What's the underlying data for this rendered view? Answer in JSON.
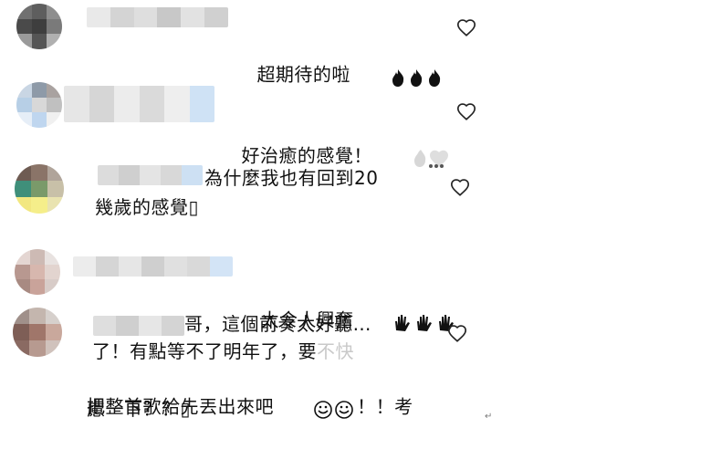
{
  "comments": [
    {
      "text_line1": "超期待的啦",
      "emoji": "fire-icon-x3"
    },
    {
      "text_line1": "好治癒的感覺！",
      "emoji": "faded-hearts-icon"
    },
    {
      "text_line1": "為什麼我也有回到20",
      "text_line2": "幾歲的感覺▯"
    },
    {
      "text_line1": "太令人興奮",
      "emoji": "raised-hands-icon-x3"
    },
    {
      "text_line1": "哥，這個前奏太好聽…",
      "text_line2a": "了！有點等不了明年了，要",
      "text_line2b": "不快",
      "text_line3": "把整首歌給先丟出來吧",
      "text_line3_end": "！！考",
      "text_line4": "慮一下？？▯"
    }
  ],
  "misc": {
    "return_mark": "↵"
  }
}
